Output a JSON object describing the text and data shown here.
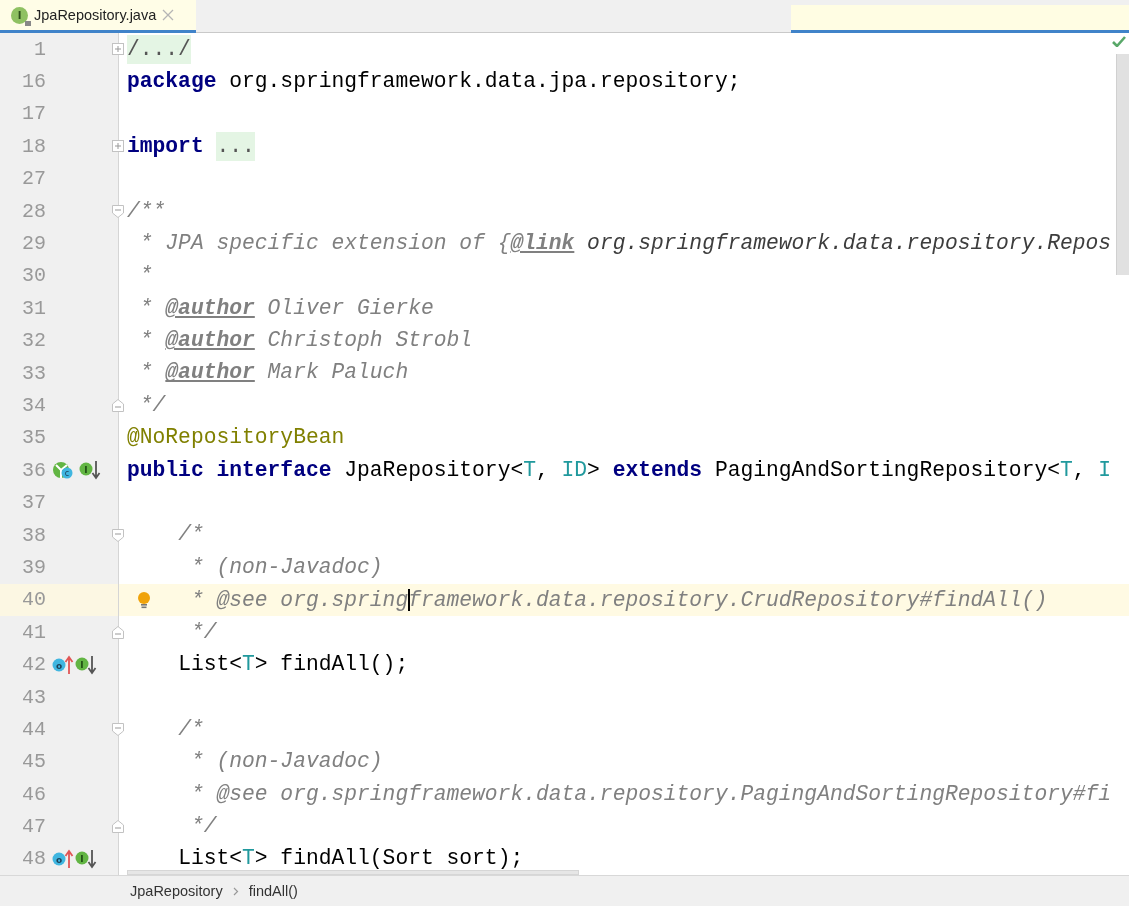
{
  "tab": {
    "icon_letter": "I",
    "label": "JpaRepository.java",
    "selected": true
  },
  "lines": [
    {
      "number": "1",
      "fold": {
        "kind": "expand"
      },
      "tokens": [
        {
          "text": "/.../",
          "kind": "folded"
        }
      ]
    },
    {
      "number": "16",
      "tokens": [
        {
          "text": "package",
          "kind": "keyword"
        },
        {
          "text": " org.springframework.data.jpa.repository;",
          "kind": "plain"
        }
      ]
    },
    {
      "number": "17"
    },
    {
      "number": "18",
      "fold": {
        "kind": "expand"
      },
      "tokens": [
        {
          "text": "import",
          "kind": "keyword"
        },
        {
          "text": "...",
          "kind": "folded"
        }
      ]
    },
    {
      "number": "27"
    },
    {
      "number": "28",
      "fold": {
        "kind": "start"
      },
      "tokens": [
        {
          "text": "/**",
          "kind": "comment"
        }
      ]
    },
    {
      "number": "29",
      "tokens": [
        {
          "text": " * JPA specific extension of {",
          "kind": "comment"
        },
        {
          "text": "@link",
          "kind": "doctag"
        },
        {
          "text": " org.springframework.data.repository.Repos",
          "kind": "docref"
        }
      ]
    },
    {
      "number": "30",
      "tokens": [
        {
          "text": " *",
          "kind": "comment"
        }
      ]
    },
    {
      "number": "31",
      "tokens": [
        {
          "text": " * ",
          "kind": "comment"
        },
        {
          "text": "@author",
          "kind": "doctag"
        },
        {
          "text": " Oliver Gierke",
          "kind": "comment"
        }
      ]
    },
    {
      "number": "32",
      "tokens": [
        {
          "text": " * ",
          "kind": "comment"
        },
        {
          "text": "@author",
          "kind": "doctag"
        },
        {
          "text": " Christoph Strobl",
          "kind": "comment"
        }
      ]
    },
    {
      "number": "33",
      "tokens": [
        {
          "text": " * ",
          "kind": "comment"
        },
        {
          "text": "@author",
          "kind": "doctag"
        },
        {
          "text": " Mark Paluch",
          "kind": "comment"
        }
      ]
    },
    {
      "number": "34",
      "fold": {
        "kind": "end"
      },
      "tokens": [
        {
          "text": " */",
          "kind": "comment"
        }
      ]
    },
    {
      "number": "35",
      "tokens": [
        {
          "text": "@NoRepositoryBean",
          "kind": "annotation"
        }
      ]
    },
    {
      "number": "36",
      "markers": [
        {
          "kind": "implementing",
          "letter": "c"
        },
        {
          "kind": "implemented",
          "letter": "I"
        }
      ],
      "tokens": [
        {
          "text": "public interface",
          "kind": "keyword"
        },
        {
          "text": " JpaRepository<",
          "kind": "plain"
        },
        {
          "text": "T",
          "kind": "typeparam"
        },
        {
          "text": ", ",
          "kind": "plain"
        },
        {
          "text": "ID",
          "kind": "typeparam"
        },
        {
          "text": "> ",
          "kind": "plain"
        },
        {
          "text": "extends",
          "kind": "keyword"
        },
        {
          "text": " PagingAndSortingRepository<",
          "kind": "plain"
        },
        {
          "text": "T",
          "kind": "typeparam"
        },
        {
          "text": ", ",
          "kind": "plain"
        },
        {
          "text": "I",
          "kind": "typeparam"
        }
      ]
    },
    {
      "number": "37"
    },
    {
      "number": "38",
      "fold": {
        "kind": "start"
      },
      "tokens": [
        {
          "text": "    /*",
          "kind": "comment"
        }
      ]
    },
    {
      "number": "39",
      "tokens": [
        {
          "text": "     * (non-Javadoc)",
          "kind": "comment"
        }
      ]
    },
    {
      "number": "40",
      "current": true,
      "bulb": true,
      "tokens": [
        {
          "text": "     * @see org.spring",
          "kind": "comment",
          "caret_after": true
        },
        {
          "text": "framework.data.repository.CrudRepository#findAll()",
          "kind": "comment"
        }
      ]
    },
    {
      "number": "41",
      "fold": {
        "kind": "end"
      },
      "tokens": [
        {
          "text": "     */",
          "kind": "comment"
        }
      ]
    },
    {
      "number": "42",
      "markers": [
        {
          "kind": "overriding",
          "letter": "o"
        },
        {
          "kind": "implemented",
          "letter": "I"
        }
      ],
      "tokens": [
        {
          "text": "    List<",
          "kind": "plain"
        },
        {
          "text": "T",
          "kind": "typeparam"
        },
        {
          "text": "> findAll();",
          "kind": "plain"
        }
      ]
    },
    {
      "number": "43"
    },
    {
      "number": "44",
      "fold": {
        "kind": "start"
      },
      "tokens": [
        {
          "text": "    /*",
          "kind": "comment"
        }
      ]
    },
    {
      "number": "45",
      "tokens": [
        {
          "text": "     * (non-Javadoc)",
          "kind": "comment"
        }
      ]
    },
    {
      "number": "46",
      "tokens": [
        {
          "text": "     * @see org.springframework.data.repository.PagingAndSortingRepository#fi",
          "kind": "comment"
        }
      ]
    },
    {
      "number": "47",
      "fold": {
        "kind": "end"
      },
      "tokens": [
        {
          "text": "     */",
          "kind": "comment"
        }
      ]
    },
    {
      "number": "48",
      "markers": [
        {
          "kind": "overriding",
          "letter": "o"
        },
        {
          "kind": "implemented",
          "letter": "I"
        }
      ],
      "tokens": [
        {
          "text": "    List<",
          "kind": "plain"
        },
        {
          "text": "T",
          "kind": "typeparam"
        },
        {
          "text": "> findAll(Sort sort);",
          "kind": "plain"
        }
      ]
    }
  ],
  "breadcrumbs": [
    "JpaRepository",
    "findAll()"
  ]
}
